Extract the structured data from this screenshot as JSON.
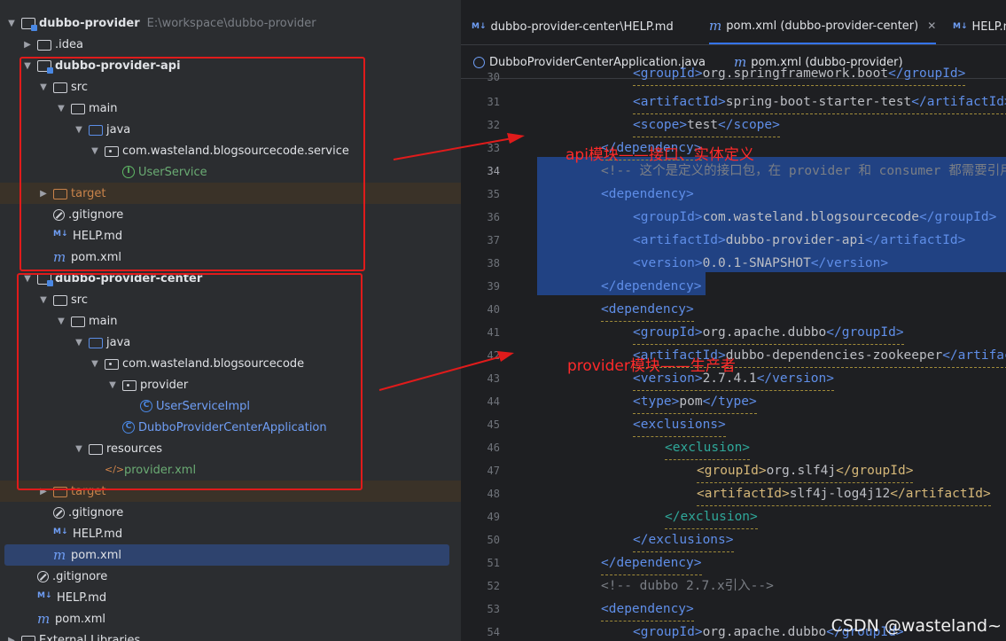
{
  "tree": {
    "root": {
      "name": "dubbo-provider",
      "path": "E:\\workspace\\dubbo-provider"
    },
    "items": {
      "idea": ".idea",
      "api_module": "dubbo-provider-api",
      "api_src": "src",
      "api_main": "main",
      "api_java": "java",
      "api_pkg": "com.wasteland.blogsourcecode.service",
      "api_userservice": "UserService",
      "api_target": "target",
      "api_gitignore": ".gitignore",
      "api_help": "HELP.md",
      "api_pom": "pom.xml",
      "center_module": "dubbo-provider-center",
      "center_src": "src",
      "center_main": "main",
      "center_java": "java",
      "center_pkg": "com.wasteland.blogsourcecode",
      "center_provider_pkg": "provider",
      "center_impl": "UserServiceImpl",
      "center_app": "DubboProviderCenterApplication",
      "center_resources": "resources",
      "center_xml": "provider.xml",
      "center_target": "target",
      "center_gitignore": ".gitignore",
      "center_help": "HELP.md",
      "center_pom": "pom.xml",
      "root_gitignore": ".gitignore",
      "root_help": "HELP.md",
      "root_pom": "pom.xml",
      "ext_libs": "External Libraries"
    }
  },
  "editor": {
    "tabs_row1": [
      "dubbo-provider-center\\HELP.md",
      "pom.xml (dubbo-provider-center)",
      "HELP.md"
    ],
    "tabs_row2": [
      "DubboProviderCenterApplication.java",
      "pom.xml (dubbo-provider)"
    ],
    "line_numbers": [
      "30",
      "31",
      "32",
      "33",
      "34",
      "35",
      "36",
      "37",
      "38",
      "39",
      "40",
      "41",
      "42",
      "43",
      "44",
      "45",
      "46",
      "47",
      "48",
      "49",
      "50",
      "51",
      "52",
      "53",
      "54"
    ],
    "lines": {
      "l30a": "<groupId>",
      "l30b": "org.springframework.boot",
      "l30c": "</groupId>",
      "l31a": "<artifactId>",
      "l31b": "spring-boot-starter-test",
      "l31c": "</artifactId>",
      "l32a": "<scope>",
      "l32b": "test",
      "l32c": "</scope>",
      "l33a": "</dependency>",
      "l34": "<!-- 这个是定义的接口包，在 provider 和 consumer 都需要引用",
      "l35": "<dependency>",
      "l36a": "<groupId>",
      "l36b": "com.wasteland.blogsourcecode",
      "l36c": "</groupId>",
      "l37a": "<artifactId>",
      "l37b": "dubbo-provider-api",
      "l37c": "</artifactId>",
      "l38a": "<version>",
      "l38b": "0.0.1-SNAPSHOT",
      "l38c": "</version>",
      "l39": "</dependency>",
      "l40": "<dependency>",
      "l41a": "<groupId>",
      "l41b": "org.apache.dubbo",
      "l41c": "</groupId>",
      "l42a": "<artifactId>",
      "l42b": "dubbo-dependencies-zookeeper",
      "l42c": "</artifactId>",
      "l43a": "<version>",
      "l43b": "2.7.4.1",
      "l43c": "</version>",
      "l44a": "<type>",
      "l44b": "pom",
      "l44c": "</type>",
      "l45": "<exclusions>",
      "l46": "<exclusion>",
      "l47a": "<groupId>",
      "l47b": "org.slf4j",
      "l47c": "</groupId>",
      "l48a": "<artifactId>",
      "l48b": "slf4j-log4j12",
      "l48c": "</artifactId>",
      "l49": "</exclusion>",
      "l50": "</exclusions>",
      "l51": "</dependency>",
      "l52": "<!-- dubbo 2.7.x引入-->",
      "l53": "<dependency>",
      "l54a": "<groupId>",
      "l54b": "org.apache.dubbo",
      "l54c": "</groupId>"
    }
  },
  "annotations": {
    "api": "api模块——接口、实体定义",
    "provider": "provider模块——生产者"
  },
  "watermark": "CSDN @wasteland~",
  "colors": {
    "annotation": "#e01b1b",
    "selection": "#214283",
    "tree_selected": "#2e436e"
  }
}
